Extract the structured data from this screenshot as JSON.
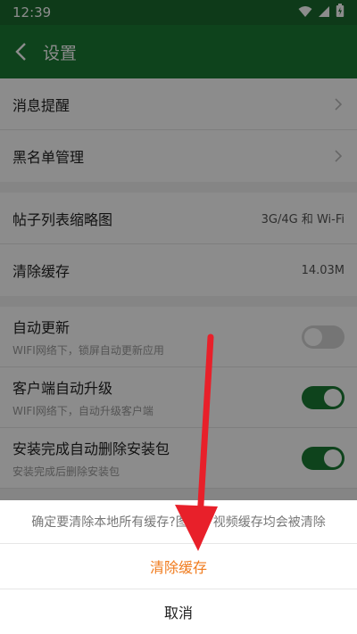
{
  "status_bar": {
    "time": "12:39"
  },
  "app_bar": {
    "title": "设置"
  },
  "settings": {
    "group1": [
      {
        "label": "消息提醒"
      },
      {
        "label": "黑名单管理"
      }
    ],
    "group2": [
      {
        "label": "帖子列表缩略图",
        "value": "3G/4G 和 Wi-Fi"
      },
      {
        "label": "清除缓存",
        "value": "14.03M"
      }
    ],
    "group3": [
      {
        "label": "自动更新",
        "sub": "WIFI网络下，锁屏自动更新应用",
        "enabled": false
      },
      {
        "label": "客户端自动升级",
        "sub": "WIFI网络下，自动升级客户端",
        "enabled": true
      },
      {
        "label": "安装完成自动删除安装包",
        "sub": "安装完成后删除安装包",
        "enabled": true
      }
    ]
  },
  "sheet": {
    "message": "确定要清除本地所有缓存?图片、视频缓存均会被清除",
    "confirm_label": "清除缓存",
    "cancel_label": "取消"
  },
  "colors": {
    "primary": "#1b7a34",
    "accent": "#f07b1d",
    "annotation": "#e8202a"
  }
}
